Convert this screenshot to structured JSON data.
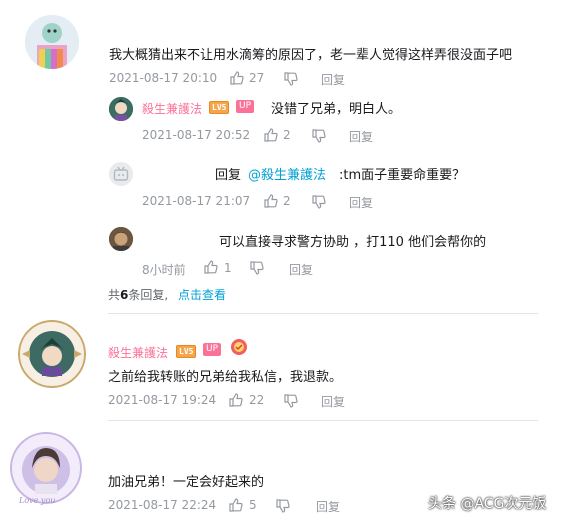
{
  "comments": [
    {
      "text": "我大概猜出来不让用水滴筹的原因了，老一辈人觉得这样弄很没面子吧",
      "time": "2021-08-17 20:10",
      "likes": "27",
      "reply": "回复",
      "replies": [
        {
          "user": "殺生兼護法",
          "level": "LV5",
          "up_badge": "UP",
          "text": "没错了兄弟，明白人。",
          "time": "2021-08-17 20:52",
          "likes": "2",
          "reply": "回复"
        },
        {
          "prefix": "回复",
          "mention": "@殺生兼護法",
          "text": ":tm面子重要命重要？",
          "time": "2021-08-17 21:07",
          "likes": "2",
          "reply": "回复"
        },
        {
          "text": "可以直接寻求警方协助 ，打110 他们会帮你的",
          "time": "8小时前",
          "likes": "1",
          "reply": "回复"
        }
      ],
      "summary": {
        "prefix": "共",
        "count": "6",
        "suffix": "条回复,",
        "link": "点击查看"
      }
    },
    {
      "user": "殺生兼護法",
      "level": "LV5",
      "up_badge": "UP",
      "text": "之前给我转账的兄弟给我私信，我退款。",
      "time": "2021-08-17 19:24",
      "likes": "22",
      "reply": "回复"
    },
    {
      "text": "加油兄弟！一定会好起来的",
      "time": "2021-08-17 22:24",
      "likes": "5",
      "reply": "回复"
    }
  ],
  "avatar_badge_text": "Love you",
  "watermark": "头条 @ACG次元饭",
  "colors": {
    "username": "#fb7299",
    "mention": "#00a1d6",
    "meta": "#9499a0",
    "level_badge": "#f7a54a"
  }
}
